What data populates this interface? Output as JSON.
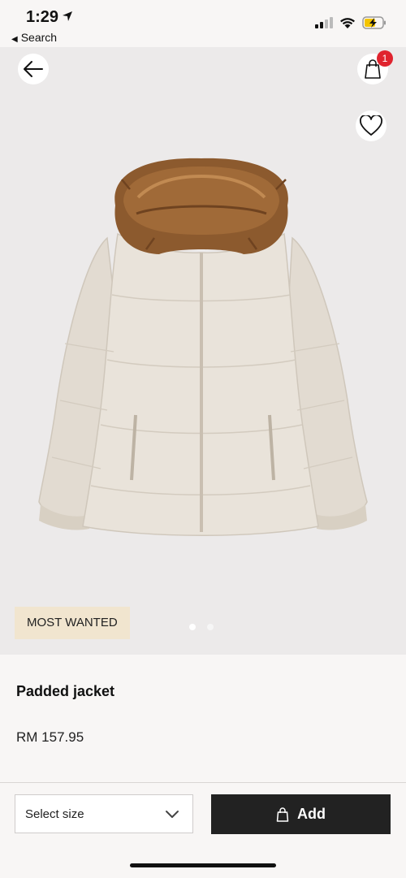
{
  "status_bar": {
    "time": "1:29",
    "back_app_label": "Search"
  },
  "header": {
    "cart_count": "1"
  },
  "product_image": {
    "tag": "MOST WANTED",
    "image_count": 2,
    "active_index": 0
  },
  "product": {
    "title": "Padded jacket",
    "price": "RM 157.95"
  },
  "actions": {
    "select_size_label": "Select size",
    "add_label": "Add"
  },
  "colors": {
    "badge": "#e0232e",
    "tag_bg": "#f1e5cf",
    "add_bg": "#222222",
    "hero_bg": "#eceaea"
  }
}
